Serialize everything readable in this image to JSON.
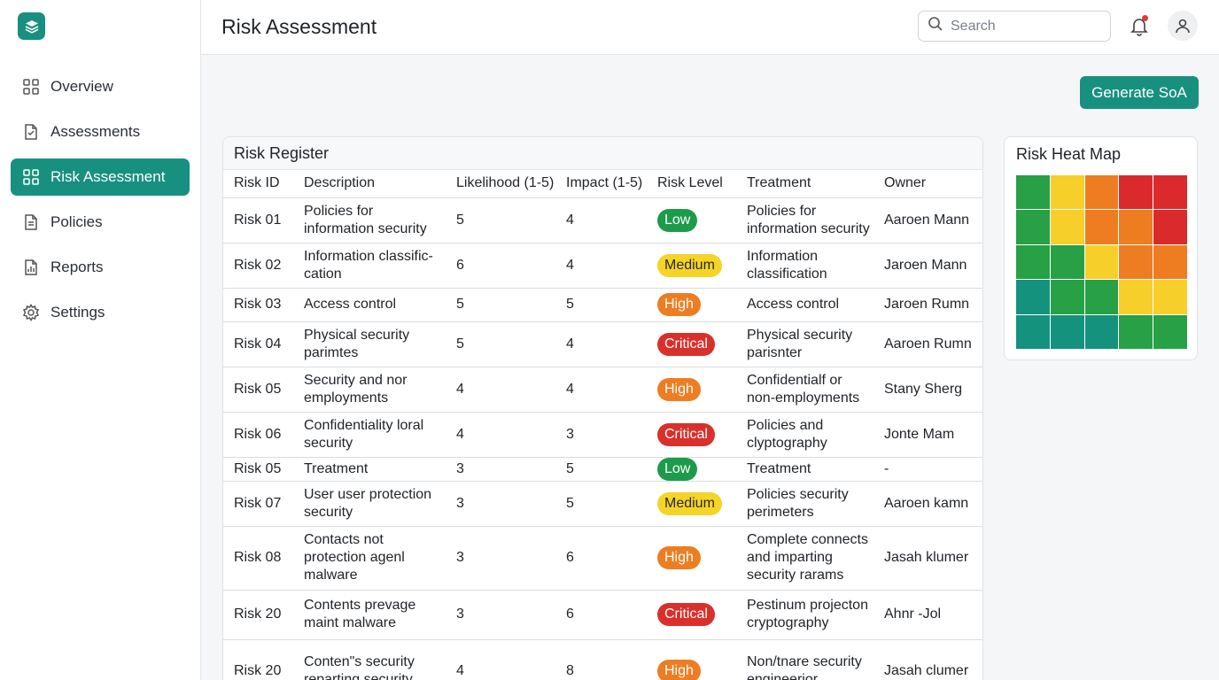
{
  "sidebar": {
    "items": [
      {
        "label": "Overview",
        "icon": "grid-icon",
        "active": false
      },
      {
        "label": "Assessments",
        "icon": "file-check-icon",
        "active": false
      },
      {
        "label": "Risk Assessment",
        "icon": "grid-icon",
        "active": true
      },
      {
        "label": "Policies",
        "icon": "document-icon",
        "active": false
      },
      {
        "label": "Reports",
        "icon": "chart-file-icon",
        "active": false
      },
      {
        "label": "Settings",
        "icon": "gear-icon",
        "active": false
      }
    ]
  },
  "header": {
    "title": "Risk Assessment",
    "search_placeholder": "Search"
  },
  "actions": {
    "generate_label": "Generate SoA"
  },
  "register": {
    "title": "Risk Register",
    "columns": [
      "Risk ID",
      "Description",
      "Likelihood (1-5)",
      "Impact (1-5)",
      "Risk Level",
      "Treatment",
      "Owner"
    ],
    "rows": [
      {
        "id": "Risk 01",
        "description": "Policies for information security",
        "likelihood": "5",
        "impact": "4",
        "level": "Low",
        "treatment": "Policies for information security",
        "owner": "Aaroen Mann"
      },
      {
        "id": "Risk 02",
        "description": "Information classific-cation",
        "likelihood": "6",
        "impact": "4",
        "level": "Medium",
        "treatment": "Information classification",
        "owner": "Jaroen Mann"
      },
      {
        "id": "Risk 03",
        "description": "Access control",
        "likelihood": "5",
        "impact": "5",
        "level": "High",
        "treatment": "Access control",
        "owner": "Jaroen Rumn"
      },
      {
        "id": "Risk 04",
        "description": "Physical security parimtes",
        "likelihood": "5",
        "impact": "4",
        "level": "Critical",
        "treatment": "Physical security parisnter",
        "owner": "Aaroen Rumn"
      },
      {
        "id": "Risk 05",
        "description": "Security and nor employments",
        "likelihood": "4",
        "impact": "4",
        "level": "High",
        "treatment": "Confidentialf or non-employments",
        "owner": "Stany Sherg"
      },
      {
        "id": "Risk 06",
        "description": "Confidentiality loral security",
        "likelihood": "4",
        "impact": "3",
        "level": "Critical",
        "treatment": "Policies and clyptography",
        "owner": "Jonte Mam"
      },
      {
        "id": "Risk 05",
        "description": "Treatment",
        "likelihood": "3",
        "impact": "5",
        "level": "Low",
        "treatment": "Treatment",
        "owner": "-"
      },
      {
        "id": "Risk 07",
        "description": "User user protection security",
        "likelihood": "3",
        "impact": "5",
        "level": "Medium",
        "treatment": "Policies security perimeters",
        "owner": "Aaroen kamn"
      },
      {
        "id": "Risk 08",
        "description": "Contacts not protection agenl malware",
        "likelihood": "3",
        "impact": "6",
        "level": "High",
        "treatment": "Complete connects and imparting security rarams",
        "owner": "Jasah klumer"
      },
      {
        "id": "Risk 20",
        "description": "Contents prevage maint malware",
        "likelihood": "3",
        "impact": "6",
        "level": "Critical",
        "treatment": "Pestinum projecton cryptography",
        "owner": "Ahnr -Jol"
      },
      {
        "id": "Risk 20",
        "description": "Conten\"s security reparting security",
        "likelihood": "4",
        "impact": "8",
        "level": "High",
        "treatment": "Non/tnare security engineerior",
        "owner": "Jasah clumer"
      }
    ]
  },
  "heatmap": {
    "title": "Risk Heat Map",
    "colors": {
      "green": "#27a046",
      "yellow": "#f7cf2a",
      "orange": "#ee7d22",
      "red": "#db2a2c",
      "teal": "#15927e"
    },
    "grid": [
      [
        "green",
        "yellow",
        "orange",
        "red",
        "red"
      ],
      [
        "green",
        "yellow",
        "orange",
        "orange",
        "red"
      ],
      [
        "green",
        "green",
        "yellow",
        "orange",
        "orange"
      ],
      [
        "teal",
        "green",
        "green",
        "yellow",
        "yellow"
      ],
      [
        "teal",
        "teal",
        "teal",
        "green",
        "green"
      ]
    ]
  },
  "level_colors": {
    "Low": "#1d9b4b",
    "Medium": "#f5d427",
    "High": "#ee7d22",
    "Critical": "#d9302c"
  }
}
